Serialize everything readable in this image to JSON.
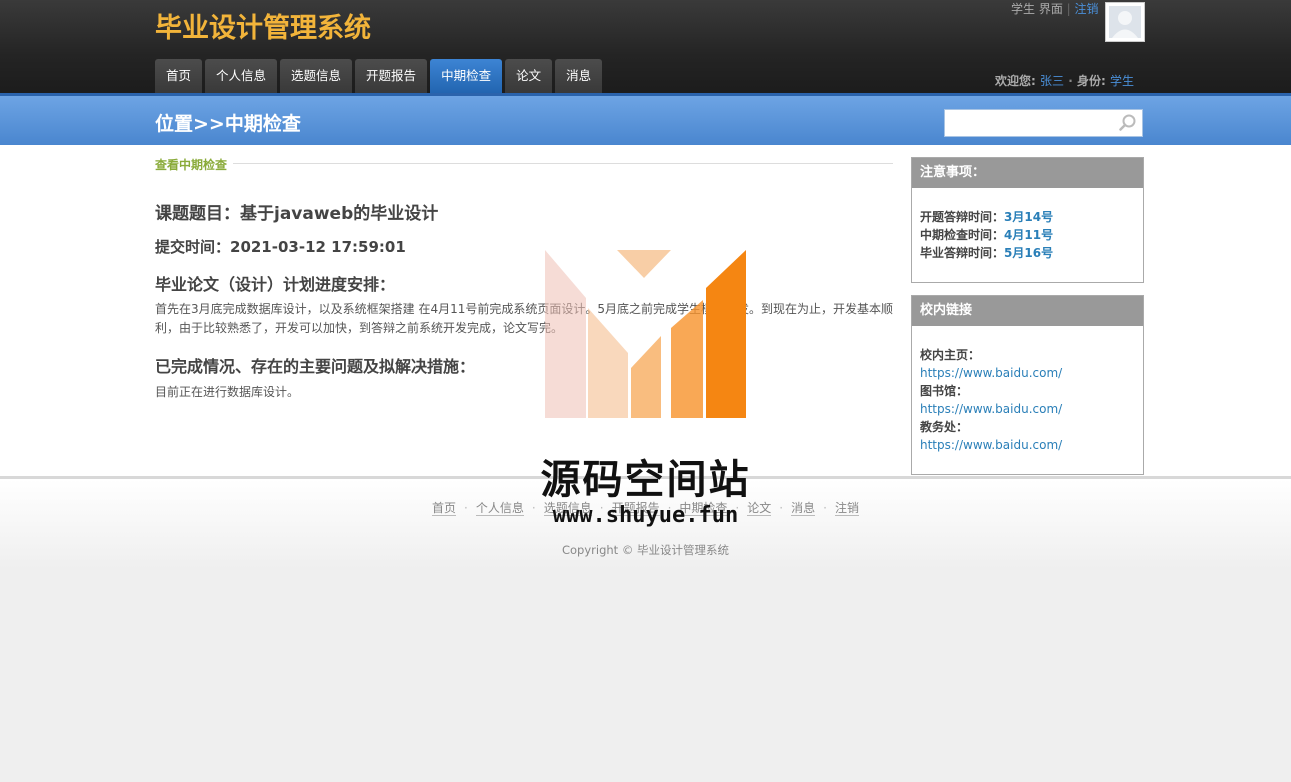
{
  "header": {
    "title": "毕业设计管理系统",
    "top_links": {
      "role_ui": "学生 界面",
      "logout": "注销"
    },
    "nav_tabs": [
      {
        "label": "首页"
      },
      {
        "label": "个人信息"
      },
      {
        "label": "选题信息"
      },
      {
        "label": "开题报告"
      },
      {
        "label": "中期检查",
        "active": true
      },
      {
        "label": "论文"
      },
      {
        "label": "消息"
      }
    ],
    "welcome": {
      "prefix": "欢迎您:",
      "name": "张三",
      "role_prefix": "身份:",
      "role": "学生"
    }
  },
  "location": {
    "title": "位置>>中期检查",
    "search_placeholder": ""
  },
  "main": {
    "section_label": "查看中期检查",
    "topic_heading": "课题题目：基于javaweb的毕业设计",
    "submit_time": "提交时间：2021-03-12 17:59:01",
    "plan_heading": "毕业论文（设计）计划进度安排：",
    "plan_text": "首先在3月底完成数据库设计，以及系统框架搭建 在4月11号前完成系统页面设计。5月底之前完成学生模块开发。到现在为止，开发基本顺利，由于比较熟悉了，开发可以加快，到答辩之前系统开发完成，论文写完。",
    "done_heading": "已完成情况、存在的主要问题及拟解决措施：",
    "done_text": "目前正在进行数据库设计。"
  },
  "sidebar": {
    "notice": {
      "title": "注意事项：",
      "items": [
        {
          "label": "开题答辩时间：",
          "value": "3月14号"
        },
        {
          "label": "中期检查时间：",
          "value": "4月11号"
        },
        {
          "label": "毕业答辩时间：",
          "value": "5月16号"
        }
      ]
    },
    "links": {
      "title": "校内链接",
      "items": [
        {
          "label": "校内主页：",
          "url": "https://www.baidu.com/"
        },
        {
          "label": "图书馆：",
          "url": "https://www.baidu.com/"
        },
        {
          "label": "教务处：",
          "url": "https://www.baidu.com/"
        }
      ]
    }
  },
  "footer": {
    "links": [
      "首页",
      "个人信息",
      "选题信息",
      "开题报告",
      "中期检查",
      "论文",
      "消息",
      "注销"
    ],
    "separator": "·",
    "copyright": "Copyright © 毕业设计管理系统"
  },
  "watermark": {
    "name": "源码空间站",
    "url": "www.shuyue.fun"
  },
  "colors": {
    "accent_blue": "#2a6fc0",
    "logo_gold": "#f2b43a",
    "section_green": "#8aab3a"
  }
}
